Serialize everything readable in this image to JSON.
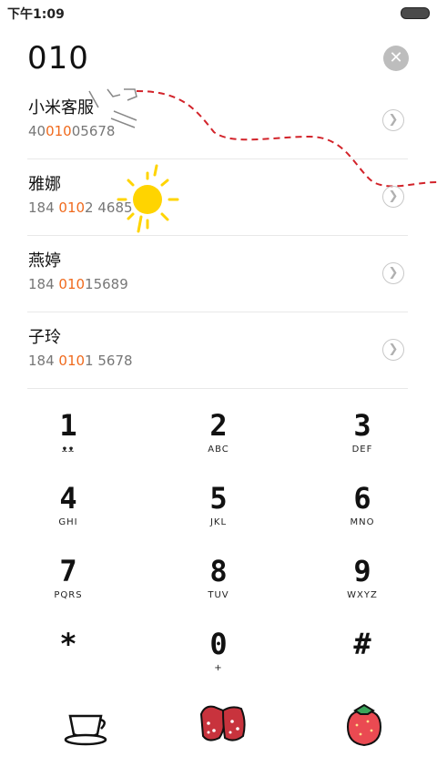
{
  "status": {
    "time": "下午1:09"
  },
  "dial": {
    "number": "010",
    "clear_icon": "close-circle-icon"
  },
  "contacts": [
    {
      "name": "小米客服",
      "pre": "40",
      "match": "010",
      "post": "05678"
    },
    {
      "name": "雅娜",
      "pre": "184 ",
      "match": "010",
      "post": "2 4685"
    },
    {
      "name": "燕婷",
      "pre": "184 ",
      "match": "010",
      "post": "15689"
    },
    {
      "name": "子玲",
      "pre": "184 ",
      "match": "010",
      "post": "1 5678"
    }
  ],
  "keypad": [
    {
      "digit": "1",
      "sub": "ᴥᴥ"
    },
    {
      "digit": "2",
      "sub": "ABC"
    },
    {
      "digit": "3",
      "sub": "DEF"
    },
    {
      "digit": "4",
      "sub": "GHI"
    },
    {
      "digit": "5",
      "sub": "JKL"
    },
    {
      "digit": "6",
      "sub": "MNO"
    },
    {
      "digit": "7",
      "sub": "PQRS"
    },
    {
      "digit": "8",
      "sub": "TUV"
    },
    {
      "digit": "9",
      "sub": "WXYZ"
    },
    {
      "digit": "*",
      "sub": ""
    },
    {
      "digit": "0",
      "sub": "+"
    },
    {
      "digit": "#",
      "sub": ""
    }
  ],
  "bottom_icons": [
    "teacup-icon",
    "mittens-icon",
    "strawberry-icon"
  ],
  "colors": {
    "highlight": "#f06a1d",
    "divider": "#e8e8e8",
    "sun": "#ffd400",
    "dashed": "#d2232a"
  }
}
